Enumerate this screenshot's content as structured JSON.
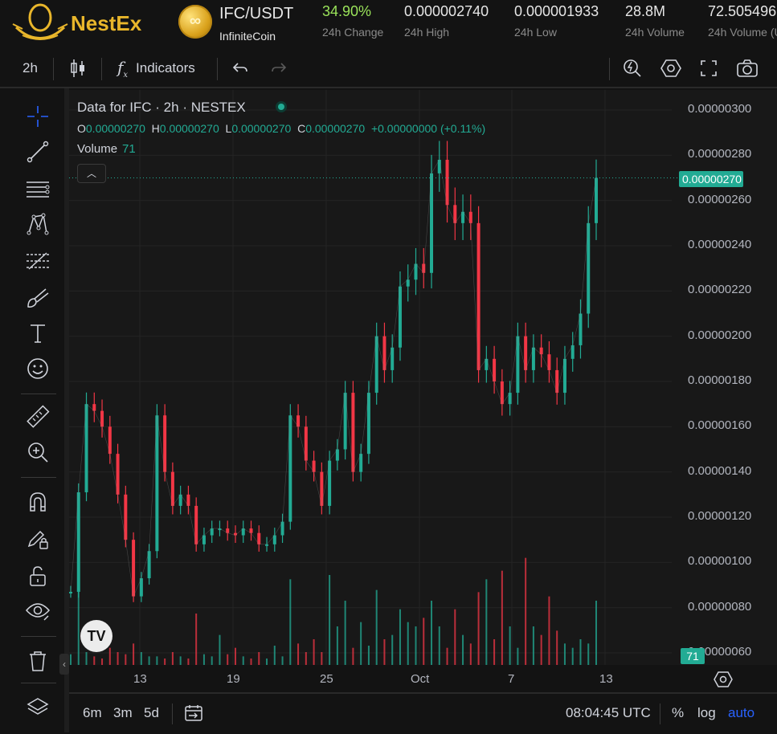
{
  "header": {
    "brand": "NestEx",
    "pair": "IFC/USDT",
    "coin_name": "InfiniteCoin",
    "stats": [
      {
        "value": "34.90%",
        "label": "24h Change"
      },
      {
        "value": "0.000002740",
        "label": "24h High"
      },
      {
        "value": "0.000001933",
        "label": "24h Low"
      },
      {
        "value": "28.8M",
        "label": "24h Volume"
      },
      {
        "value": "72.505496",
        "label": "24h Volume (U"
      }
    ]
  },
  "toolbar": {
    "interval": "2h",
    "indicators_label": "Indicators"
  },
  "legend": {
    "title": "Data for IFC · 2h · NESTEX",
    "o_label": "O",
    "o": "0.00000270",
    "h_label": "H",
    "h": "0.00000270",
    "l_label": "L",
    "l": "0.00000270",
    "c_label": "C",
    "c": "0.00000270",
    "change": "+0.00000000 (+0.11%)",
    "volume_label": "Volume",
    "volume": "71"
  },
  "price_axis": {
    "labels": [
      "0.00000300",
      "0.00000280",
      "0.00000260",
      "0.00000240",
      "0.00000220",
      "0.00000200",
      "0.00000180",
      "0.00000160",
      "0.00000140",
      "0.00000120",
      "0.00000100",
      "0.00000080",
      "0.00000060"
    ],
    "current_price": "0.00000270",
    "current_volume": "71"
  },
  "time_axis": {
    "labels": [
      "13",
      "19",
      "25",
      "Oct",
      "7",
      "13"
    ]
  },
  "bottom_bar": {
    "ranges": [
      "6m",
      "3m",
      "5d"
    ],
    "time": "08:04:45 UTC",
    "percent": "%",
    "log": "log",
    "auto": "auto"
  },
  "colors": {
    "up": "#22ab94",
    "down": "#f23645",
    "accent": "#2962ff",
    "brand": "#e9b62b"
  },
  "chart_data": {
    "type": "line",
    "title": "Data for IFC · 2h · NESTEX",
    "ylim": [
      5.5e-07,
      3.05e-06
    ],
    "series": [
      {
        "name": "IFC",
        "x": [
          9.5,
          10,
          10.5,
          11,
          11.5,
          12,
          12.5,
          13,
          13.5,
          14,
          14.5,
          15,
          15.5,
          16,
          16.5,
          17,
          17.5,
          18,
          18.5,
          19,
          19.5,
          20,
          20.5,
          21,
          21.5,
          22,
          22.5,
          23,
          23.5,
          24,
          24.5,
          25,
          25.5,
          26,
          26.5,
          27,
          27.5,
          28,
          28.5,
          29,
          29.5,
          30,
          30.5,
          31,
          31.5,
          32,
          32.5,
          33,
          33.5,
          34,
          34.5,
          35,
          35.5,
          36,
          36.5,
          37,
          37.5,
          38,
          38.5,
          39,
          39.5,
          40,
          40.5,
          41,
          41.5,
          42,
          42.5,
          43
        ],
        "values": [
          8.7e-07,
          1.31e-06,
          1.7e-06,
          1.67e-06,
          1.6e-06,
          1.48e-06,
          1.3e-06,
          1.1e-06,
          8.5e-07,
          9.3e-07,
          1.05e-06,
          1.65e-06,
          1.4e-06,
          1.25e-06,
          1.3e-06,
          1.25e-06,
          1.08e-06,
          1.12e-06,
          1.15e-06,
          1.15e-06,
          1.13e-06,
          1.12e-06,
          1.15e-06,
          1.13e-06,
          1.08e-06,
          1.08e-06,
          1.12e-06,
          1.18e-06,
          1.65e-06,
          1.6e-06,
          1.45e-06,
          1.4e-06,
          1.25e-06,
          1.45e-06,
          1.5e-06,
          1.75e-06,
          1.4e-06,
          1.48e-06,
          1.75e-06,
          2e-06,
          1.85e-06,
          1.95e-06,
          2.22e-06,
          2.25e-06,
          2.32e-06,
          2.28e-06,
          2.72e-06,
          2.78e-06,
          2.58e-06,
          2.5e-06,
          2.55e-06,
          2.5e-06,
          1.85e-06,
          1.9e-06,
          1.8e-06,
          1.7e-06,
          1.75e-06,
          2e-06,
          1.85e-06,
          1.95e-06,
          1.92e-06,
          1.85e-06,
          1.75e-06,
          1.9e-06,
          1.96e-06,
          2.1e-06,
          2.5e-06,
          2.7e-06
        ]
      }
    ],
    "volume": [
      5,
      38,
      6,
      4,
      3,
      8,
      6,
      5,
      10,
      6,
      4,
      4,
      3,
      6,
      4,
      3,
      24,
      5,
      4,
      14,
      5,
      8,
      4,
      3,
      6,
      3,
      9,
      4,
      40,
      10,
      6,
      12,
      6,
      42,
      18,
      30,
      8,
      20,
      9,
      35,
      12,
      14,
      26,
      20,
      18,
      22,
      30,
      18,
      8,
      26,
      14,
      10,
      34,
      40,
      12,
      44,
      18,
      8,
      50,
      18,
      14,
      32,
      16,
      10,
      8,
      12,
      10,
      30
    ],
    "x_tick_labels": [
      "13",
      "19",
      "25",
      "Oct",
      "7",
      "13"
    ],
    "grid": true
  }
}
